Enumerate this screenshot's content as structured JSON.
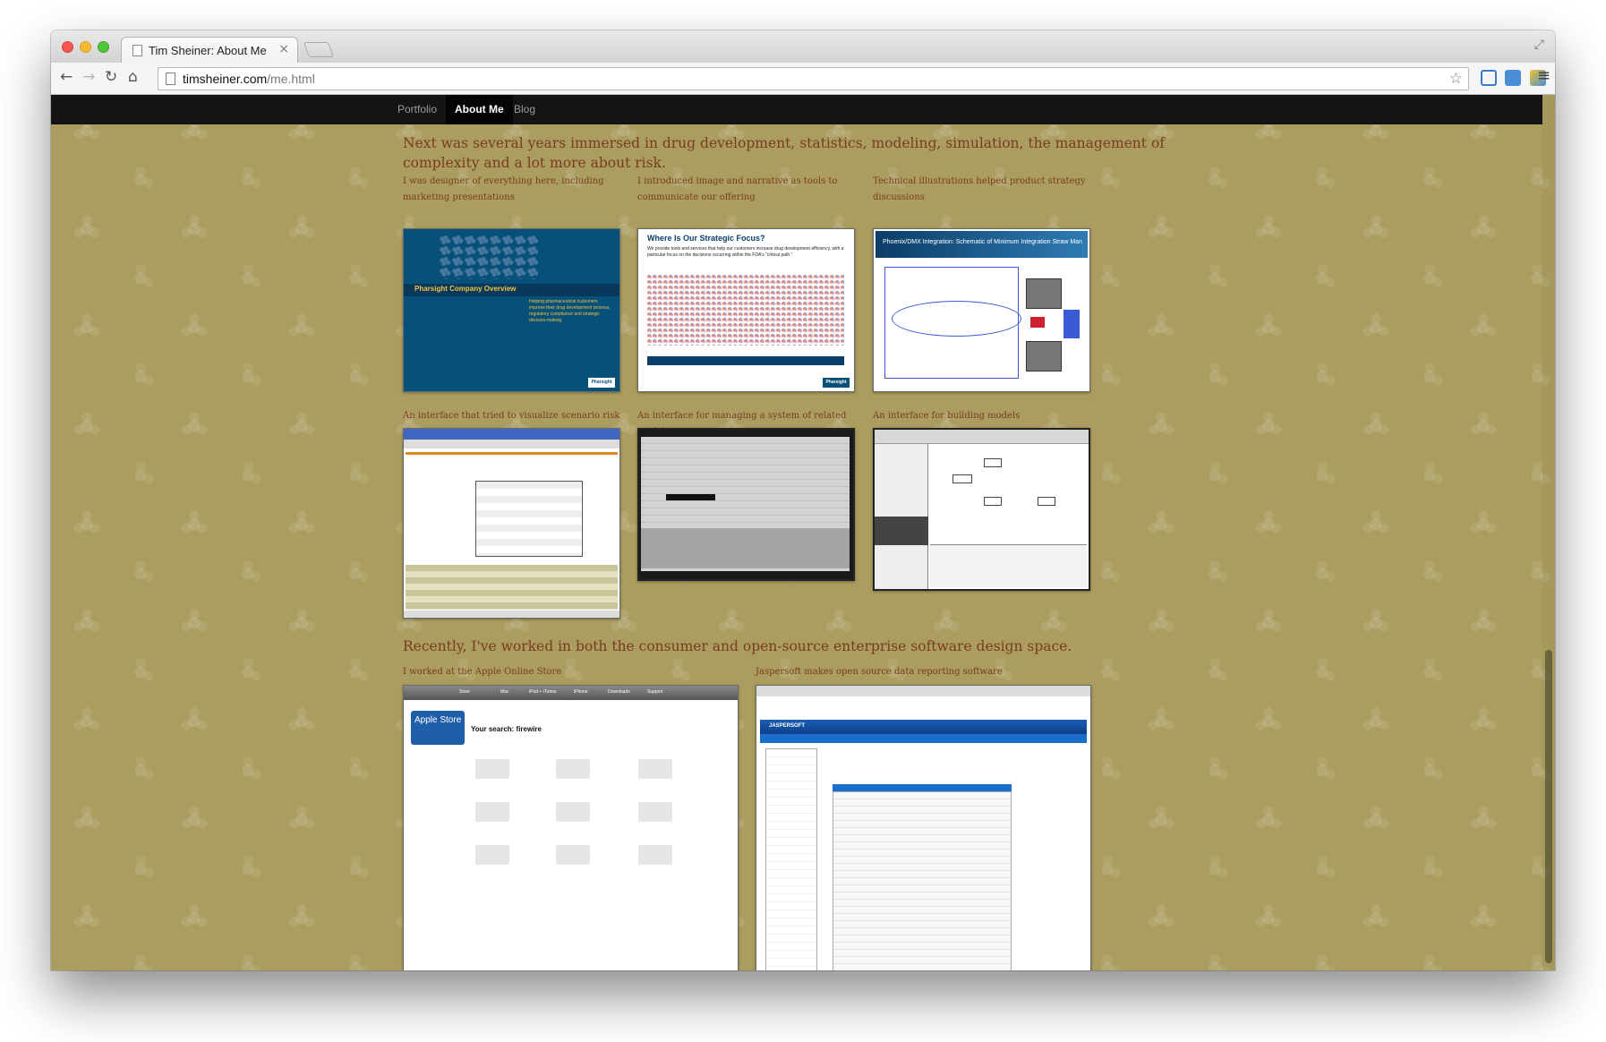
{
  "browser": {
    "tab_title": "Tim Sheiner: About Me",
    "tab_close": "×",
    "url_host": "timsheiner.com",
    "url_path": "/me.html",
    "icons": [
      "back-arrow-icon",
      "forward-arrow-icon",
      "reload-icon",
      "home-icon",
      "bookmark-star-icon",
      "menu-icon"
    ]
  },
  "site_nav": {
    "items": [
      {
        "label": "Portfolio",
        "active": false
      },
      {
        "label": "About Me",
        "active": true
      },
      {
        "label": "Blog",
        "active": false
      }
    ]
  },
  "section1": {
    "headline": "Next was several years immersed in drug development, statistics, modeling, simulation, the management of complexity and a lot more about risk.",
    "captions": [
      "I was designer of everything here, including marketing presentations",
      "I introduced image and narrative as tools to communicate our offering",
      "Technical illustrations helped product strategy discussions",
      "An interface that tried to visualize scenario risk",
      "An interface for managing a system of related models",
      "An interface for building models"
    ],
    "thumb_texts": {
      "overview_title": "Pharsight Company Overview",
      "overview_sub": "Helping pharmaceutical customers improve their drug development process, regulatory compliance and strategic decision-making.",
      "logo": "Pharsight",
      "slide_title": "Where Is Our Strategic Focus?",
      "slide_body": "We provide tools and services that help our customers increase drug development efficiency, with a particular focus on the decisions occurring within the FDA's \"critical path.\"",
      "diagram_title": "Phoenix/DMX Integration: Schematic of Minimum Integration Straw Man"
    }
  },
  "section2": {
    "headline": "Recently, I've worked in both the consumer and open-source enterprise software design space.",
    "captions": [
      "I worked at the Apple Online Store",
      "Jaspersoft makes open source data reporting software"
    ],
    "thumb_texts": {
      "apple_nav": [
        "Store",
        "Mac",
        "iPod + iTunes",
        "iPhone",
        "Downloads",
        "Support"
      ],
      "apple_store": "Apple Store",
      "apple_search": "Your search: firewire",
      "jasper_brand": "JASPERSOFT"
    }
  }
}
